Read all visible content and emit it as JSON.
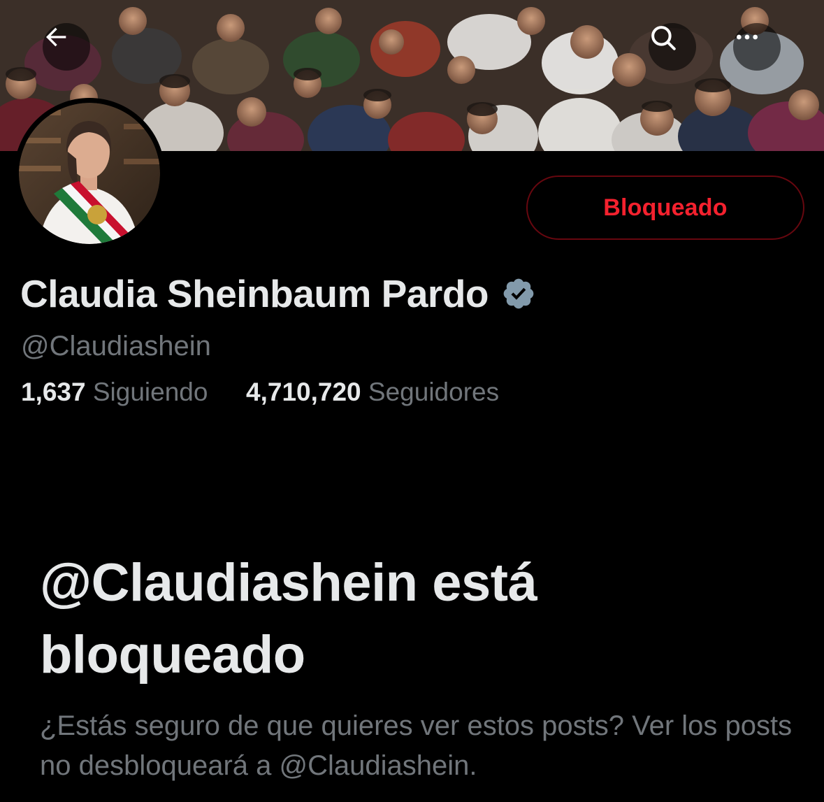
{
  "profile": {
    "display_name": "Claudia Sheinbaum Pardo",
    "handle": "@Claudiashein",
    "verified": true,
    "following_count": "1,637",
    "following_label": "Siguiendo",
    "followers_count": "4,710,720",
    "followers_label": "Seguidores"
  },
  "actions": {
    "blocked_label": "Bloqueado"
  },
  "blocked_notice": {
    "title": "@Claudiashein está bloqueado",
    "body": "¿Estás seguro de que quieres ver estos posts? Ver los posts no desbloqueará a @Claudiashein."
  },
  "icons": {
    "back": "arrow-left-icon",
    "search": "search-icon",
    "more": "more-horizontal-icon",
    "verified": "verified-badge-icon"
  },
  "colors": {
    "background": "#000000",
    "primary_text": "#e7e9ea",
    "secondary_text": "#71767b",
    "blocked_red": "#f4212e",
    "blocked_border": "#67070f",
    "verified_badge": "#829aab"
  }
}
